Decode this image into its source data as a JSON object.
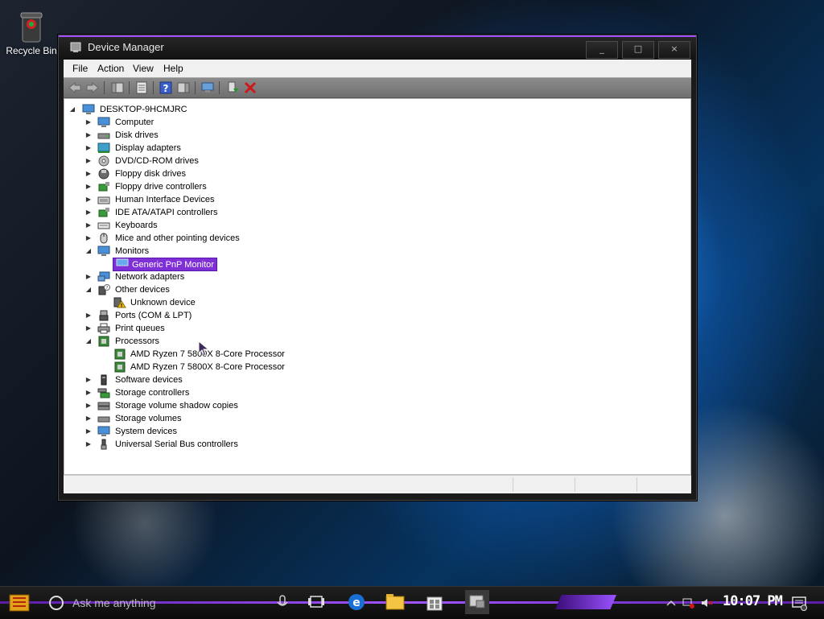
{
  "desktop": {
    "recycle_bin_label": "Recycle Bin"
  },
  "window": {
    "title": "Device Manager",
    "controls": {
      "minimize": "_",
      "maximize": "□",
      "close": "×"
    }
  },
  "menu": [
    "File",
    "Action",
    "View",
    "Help"
  ],
  "tree": {
    "root": "DESKTOP-9HCMJRC",
    "items": [
      "Computer",
      "Disk drives",
      "Display adapters",
      "DVD/CD-ROM drives",
      "Floppy disk drives",
      "Floppy drive controllers",
      "Human Interface Devices",
      "IDE ATA/ATAPI controllers",
      "Keyboards",
      "Mice and other pointing devices",
      "Monitors",
      "Generic PnP Monitor",
      "Network adapters",
      "Other devices",
      "Unknown device",
      "Ports (COM & LPT)",
      "Print queues",
      "Processors",
      "AMD Ryzen 7 5800X 8-Core Processor",
      "AMD Ryzen 7 5800X 8-Core Processor",
      "Software devices",
      "Storage controllers",
      "Storage volume shadow copies",
      "Storage volumes",
      "System devices",
      "Universal Serial Bus controllers"
    ]
  },
  "taskbar": {
    "search_placeholder": "Ask me anything",
    "clock": "10:07 PM"
  },
  "colors": {
    "selection": "#7f2fd6",
    "accent_purple": "#9b4dff",
    "error_red": "#d01818"
  }
}
